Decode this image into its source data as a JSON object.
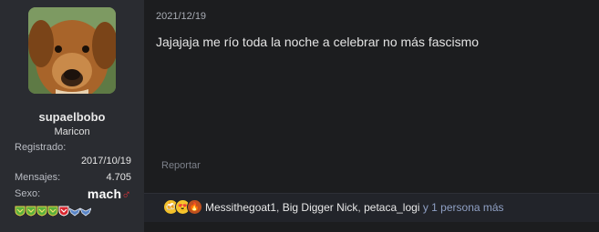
{
  "user": {
    "username": "supaelbobo",
    "title": "Maricon",
    "registered_label": "Registrado:",
    "registered_value": "2017/10/19",
    "messages_label": "Mensajes:",
    "messages_value": "4.705",
    "sex_label": "Sexo:",
    "sex_value": "mach",
    "sex_symbol": "♂",
    "badges": [
      "shield-green",
      "shield-green",
      "shield-green",
      "shield-green",
      "shield-red",
      "wings-blue",
      "wings-blue"
    ]
  },
  "post": {
    "date": "2021/12/19",
    "message": "Jajajaja me río toda la noche a celebrar no más fascismo",
    "report_label": "Reportar"
  },
  "reactions": {
    "icons": [
      "cheers-icon",
      "heart-eyes-icon",
      "fire-icon"
    ],
    "user1": "Messithegoat1",
    "user2": "Big Digger Nick",
    "user3": "petaca_logi",
    "more": "y 1 persona más"
  },
  "colors": {
    "sidebar_bg": "#2a2c31",
    "content_bg": "#1c1d1f",
    "accent_red": "#e0333a",
    "more_link": "#8fa0c4"
  }
}
